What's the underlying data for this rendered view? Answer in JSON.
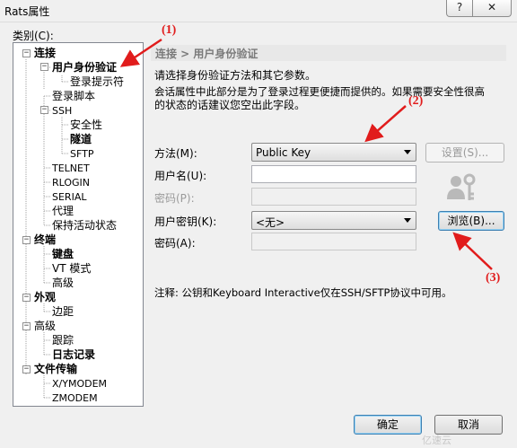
{
  "window": {
    "title": "Rats属性",
    "help_glyph": "?",
    "close_glyph": "✕"
  },
  "category_label": "类别(C):",
  "tree": {
    "connection": "连接",
    "auth": "用户身份验证",
    "login_prompt": "登录提示符",
    "login_script": "登录脚本",
    "ssh": "SSH",
    "security": "安全性",
    "tunnel": "隧道",
    "sftp": "SFTP",
    "telnet": "TELNET",
    "rlogin": "RLOGIN",
    "serial": "SERIAL",
    "proxy": "代理",
    "keepalive": "保持活动状态",
    "terminal": "终端",
    "keyboard": "键盘",
    "vt_mode": "VT 模式",
    "advanced_t": "高级",
    "appearance": "外观",
    "margin": "边距",
    "advanced": "高级",
    "trace": "跟踪",
    "logging": "日志记录",
    "file_transfer": "文件传输",
    "xymodem": "X/YMODEM",
    "zmodem": "ZMODEM"
  },
  "panel": {
    "breadcrumb": "连接 > 用户身份验证",
    "desc1": "请选择身份验证方法和其它参数。",
    "desc2": "会话属性中此部分是为了登录过程更便捷而提供的。如果需要安全性很高",
    "desc3": "的状态的话建议您空出此字段。",
    "method_label": "方法(M):",
    "method_value": "Public Key",
    "settings_button": "设置(S)...",
    "username_label": "用户名(U):",
    "username_value": "",
    "password_label": "密码(P):",
    "userkey_label": "用户密钥(K):",
    "userkey_value": "<无>",
    "browse_button": "浏览(B)...",
    "passphrase_label": "密码(A):",
    "passphrase_value": "",
    "note": "注释: 公钥和Keyboard Interactive仅在SSH/SFTP协议中可用。"
  },
  "footer": {
    "ok": "确定",
    "cancel": "取消"
  },
  "annotations": {
    "a1": "(1)",
    "a2": "(2)",
    "a3": "(3)"
  },
  "watermark": "亿速云",
  "colors": {
    "annotation": "#e11c1c",
    "header_bg": "#e8e8e8"
  }
}
